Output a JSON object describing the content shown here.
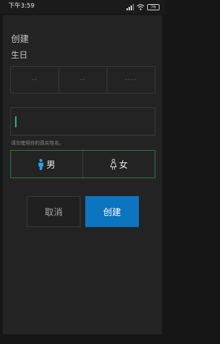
{
  "status_bar": {
    "time": "下午3:59",
    "battery": "76"
  },
  "dialog": {
    "title": "创建",
    "birthday_label": "生日",
    "date_placeholders": [
      "--",
      "--",
      "----"
    ],
    "name_value": "",
    "name_hint": "请勿使用你的真实姓名。",
    "gender": {
      "male_label": "男",
      "female_label": "女",
      "selected": "none"
    },
    "cancel_label": "取消",
    "create_label": "创建"
  },
  "colors": {
    "accent_blue": "#0c75c0",
    "accent_green": "#2f7d45",
    "male_icon": "#29a4e8"
  },
  "icons": [
    "signal-icon",
    "wifi-icon",
    "battery-icon",
    "male-icon",
    "female-icon"
  ]
}
